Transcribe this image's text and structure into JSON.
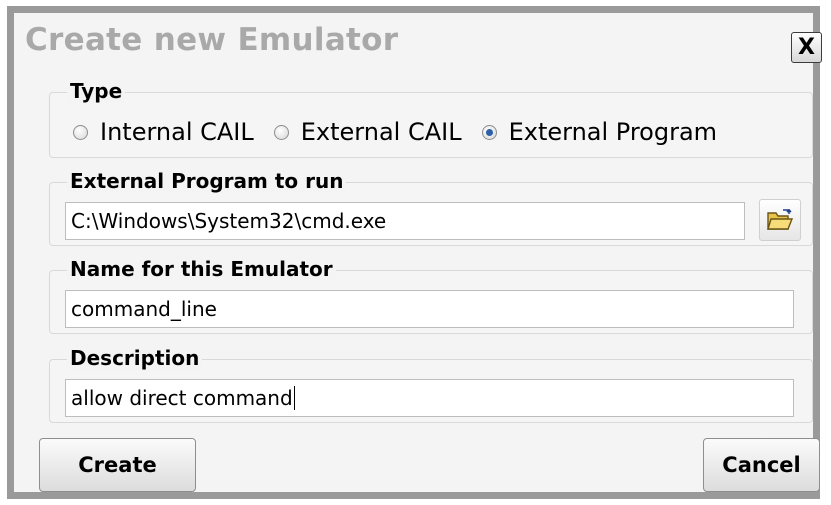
{
  "dialog": {
    "title": "Create new Emulator",
    "close_label": "X"
  },
  "type_group": {
    "legend": "Type",
    "options": [
      {
        "label": "Internal CAIL",
        "checked": false
      },
      {
        "label": "External CAIL",
        "checked": false
      },
      {
        "label": "External Program",
        "checked": true
      }
    ]
  },
  "program_group": {
    "legend": "External Program to run",
    "value": "C:\\Windows\\System32\\cmd.exe",
    "browse_icon": "open-folder-icon"
  },
  "name_group": {
    "legend": "Name for this Emulator",
    "value": "command_line"
  },
  "description_group": {
    "legend": "Description",
    "value": "allow direct command"
  },
  "buttons": {
    "create_label": "Create",
    "cancel_label": "Cancel"
  }
}
